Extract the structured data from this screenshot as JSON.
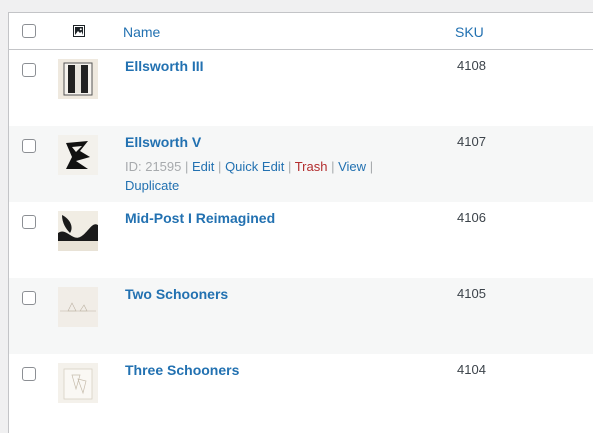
{
  "header": {
    "image_column_icon": "image-icon",
    "name_label": "Name",
    "sku_label": "SKU"
  },
  "products": [
    {
      "name": "Ellsworth III",
      "sku": "4108"
    },
    {
      "name": "Ellsworth V",
      "sku": "4107",
      "row_actions": {
        "id_text": "ID: 21595",
        "edit": "Edit",
        "quick_edit": "Quick Edit",
        "trash": "Trash",
        "view": "View",
        "duplicate": "Duplicate",
        "separator": "|"
      }
    },
    {
      "name": "Mid-Post I Reimagined",
      "sku": "4106"
    },
    {
      "name": "Two Schooners",
      "sku": "4105"
    },
    {
      "name": "Three Schooners",
      "sku": "4104"
    }
  ],
  "colors": {
    "link": "#2271b1",
    "trash": "#b32d2e",
    "alt_row": "#f6f7f7"
  }
}
